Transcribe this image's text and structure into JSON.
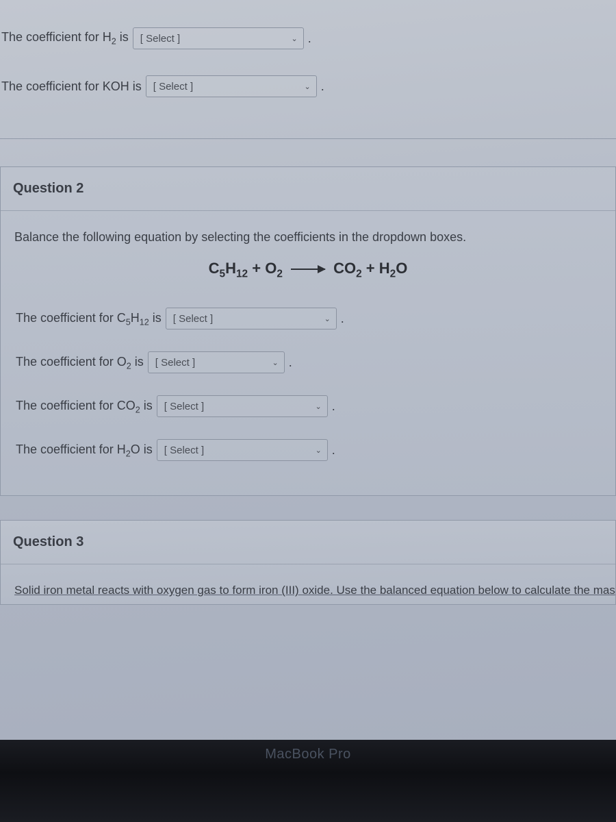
{
  "top": {
    "h2_label_pre": "The coefficient for H",
    "h2_label_sub": "2",
    "h2_label_post": " is",
    "koh_label": "The coefficient for KOH is"
  },
  "select_placeholder": "[ Select ]",
  "q2": {
    "title": "Question 2",
    "prompt": "Balance the following equation by selecting the coefficients in the dropdown boxes.",
    "eq": {
      "r1": "C",
      "r1s1": "5",
      "r1m": "H",
      "r1s2": "12",
      "plus1": " + ",
      "r2": "O",
      "r2s": "2",
      "p1": "CO",
      "p1s": "2",
      "plus2": " + ",
      "p2": "H",
      "p2s": "2",
      "p2e": "O"
    },
    "rows": {
      "c5h12_pre": "The coefficient for C",
      "c5h12_s1": "5",
      "c5h12_mid": "H",
      "c5h12_s2": "12",
      "c5h12_post": " is",
      "o2_pre": "The coefficient for O",
      "o2_s": "2",
      "o2_post": " is",
      "co2_pre": "The coefficient for CO",
      "co2_s": "2",
      "co2_post": " is",
      "h2o_pre": "The coefficient for H",
      "h2o_s": "2",
      "h2o_post": "O is"
    }
  },
  "q3": {
    "title": "Question 3",
    "text": "Solid iron metal reacts with oxygen gas to form iron (III) oxide.  Use the balanced equation below to calculate the mas"
  },
  "device": "MacBook Pro"
}
